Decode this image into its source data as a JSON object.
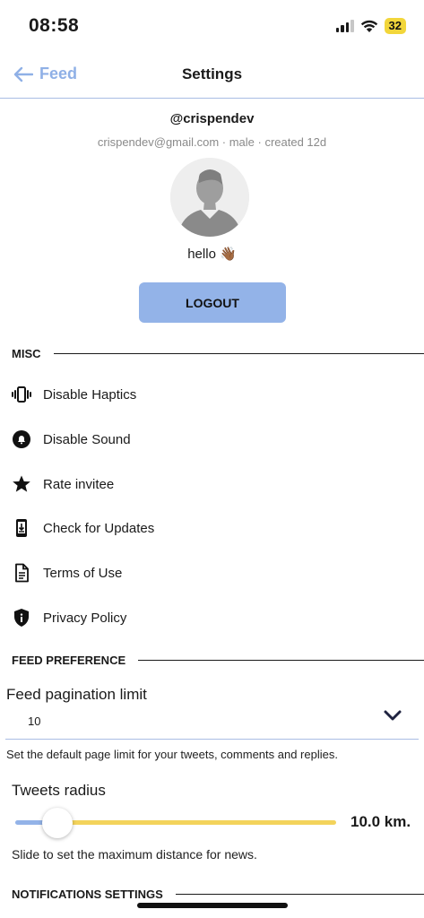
{
  "status_bar": {
    "time": "08:58",
    "battery": "32"
  },
  "header": {
    "back_label": "Feed",
    "title": "Settings"
  },
  "profile": {
    "handle": "@crispendev",
    "meta": "crispendev@gmail.com · male · created 12d",
    "bio": "hello 👋🏾",
    "logout_label": "LOGOUT"
  },
  "misc": {
    "title": "MISC",
    "items": [
      {
        "label": "Disable Haptics",
        "icon": "vibration-icon"
      },
      {
        "label": "Disable Sound",
        "icon": "bell-icon"
      },
      {
        "label": "Rate invitee",
        "icon": "star-icon"
      },
      {
        "label": "Check for Updates",
        "icon": "download-phone-icon"
      },
      {
        "label": "Terms of Use",
        "icon": "document-icon"
      },
      {
        "label": "Privacy Policy",
        "icon": "shield-icon"
      }
    ]
  },
  "feed_preference": {
    "title": "FEED PREFERENCE",
    "pagination_label": "Feed pagination limit",
    "pagination_value": "10",
    "pagination_helper": "Set the default page limit for your tweets, comments and replies.",
    "radius_label": "Tweets radius",
    "radius_value": "10.0 km.",
    "radius_fraction": 0.13,
    "radius_helper": "Slide to set the maximum distance for news."
  },
  "notifications": {
    "title": "NOTIFICATIONS SETTINGS"
  },
  "colors": {
    "accent": "#93b3e8",
    "slider_track": "#f3d35b",
    "battery": "#f2d63b"
  }
}
